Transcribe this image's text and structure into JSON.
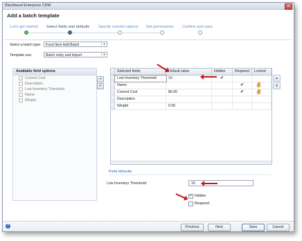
{
  "window": {
    "title": "Blackbaud Enterprise CRM",
    "close_label": "X"
  },
  "dialog": {
    "title": "Add a batch template"
  },
  "steps": [
    {
      "label": "Let's get started",
      "state": "done"
    },
    {
      "label": "Select fields and defaults",
      "state": "current"
    },
    {
      "label": "Specify commit options",
      "state": "pending"
    },
    {
      "label": "Set permissions",
      "state": "pending"
    },
    {
      "label": "Confirm and save",
      "state": "pending"
    }
  ],
  "form": {
    "batch_type_label": "Select a batch type:",
    "batch_type_value": "Food Item Add Batch",
    "template_use_label": "Template use:",
    "template_use_value": "Batch entry and import"
  },
  "available": {
    "header": "Available field options",
    "items": [
      "Current Cost",
      "Description",
      "Low Inventory Threshold",
      "Name",
      "Weight"
    ]
  },
  "grid": {
    "headers": [
      "Selected fields",
      "Default value",
      "Hidden",
      "Required",
      "Locked"
    ],
    "rows": [
      {
        "field": "Low Inventory Threshold",
        "default": "10",
        "hidden": "✔",
        "required": "",
        "locked": false
      },
      {
        "field": "Name",
        "default": "",
        "hidden": "",
        "required": "✔",
        "locked": true
      },
      {
        "field": "Current Cost",
        "default": "$0.00",
        "hidden": "",
        "required": "✔",
        "locked": true
      },
      {
        "field": "Description",
        "default": "",
        "hidden": "",
        "required": "",
        "locked": false
      },
      {
        "field": "Weight",
        "default": "0.00",
        "hidden": "",
        "required": "",
        "locked": false
      }
    ]
  },
  "field_defaults": {
    "title": "Field defaults",
    "threshold_label": "Low Inventory Threshold:",
    "threshold_value": "10",
    "hidden_label": "Hidden",
    "hidden_checked": "✔",
    "required_label": "Required"
  },
  "footer": {
    "help": "?",
    "previous": "Previous",
    "next": "Next",
    "save": "Save",
    "cancel": "Cancel"
  },
  "colors": {
    "accent": "#2f6db5",
    "annotation": "#c8161d",
    "done": "#5cb85c"
  }
}
